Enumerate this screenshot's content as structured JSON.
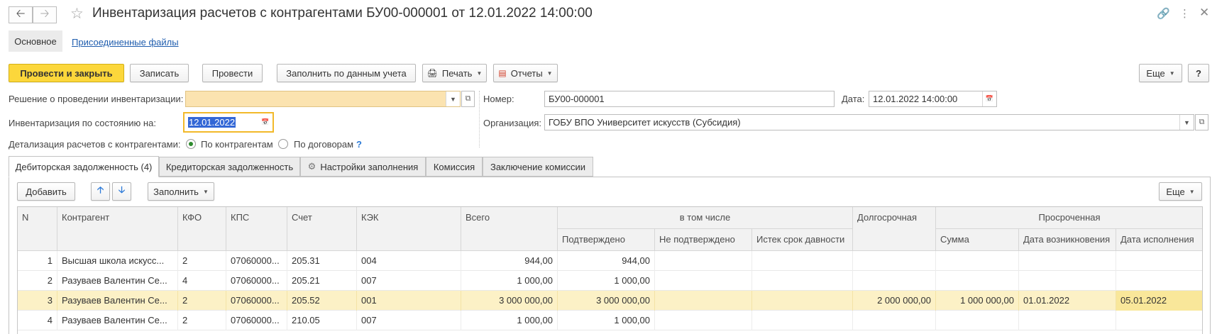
{
  "window": {
    "title": "Инвентаризация расчетов с контрагентами БУ00-000001 от 12.01.2022 14:00:00"
  },
  "section_tabs": {
    "main": "Основное",
    "files": "Присоединенные файлы"
  },
  "toolbar": {
    "post_close": "Провести и закрыть",
    "save": "Записать",
    "post": "Провести",
    "fill": "Заполнить по данным учета",
    "print": "Печать",
    "reports": "Отчеты",
    "more": "Еще",
    "help": "?"
  },
  "form": {
    "decision_label": "Решение о проведении инвентаризации:",
    "decision_value": "",
    "state_label": "Инвентаризация по состоянию на:",
    "state_value": "12.01.2022",
    "detail_label": "Детализация расчетов с контрагентами:",
    "detail_opt1": "По контрагентам",
    "detail_opt2": "По договорам",
    "detail_help": "?",
    "number_label": "Номер:",
    "number_value": "БУ00-000001",
    "date_label": "Дата:",
    "date_value": "12.01.2022 14:00:00",
    "org_label": "Организация:",
    "org_value": "ГОБУ ВПО Университет искусств (Субсидия)"
  },
  "doc_tabs": [
    "Дебиторская задолженность (4)",
    "Кредиторская задолженность",
    "Настройки заполнения",
    "Комиссия",
    "Заключение комиссии"
  ],
  "table_toolbar": {
    "add": "Добавить",
    "fill": "Заполнить",
    "more": "Еще"
  },
  "table": {
    "headers": {
      "n": "N",
      "contractor": "Контрагент",
      "kfo": "КФО",
      "kps": "КПС",
      "account": "Счет",
      "kek": "КЭК",
      "total": "Всего",
      "incl": "в том числе",
      "confirmed": "Подтверждено",
      "not_confirmed": "Не подтверждено",
      "expired": "Истек срок давности",
      "longterm": "Долгосрочная",
      "overdue": "Просроченная",
      "sum": "Сумма",
      "date_origin": "Дата возникновения",
      "date_exec": "Дата исполнения"
    },
    "rows": [
      {
        "n": "1",
        "contractor": "Высшая школа искусс...",
        "kfo": "2",
        "kps": "07060000...",
        "account": "205.31",
        "kek": "004",
        "total": "944,00",
        "confirmed": "944,00",
        "not_confirmed": "",
        "expired": "",
        "longterm": "",
        "sum": "",
        "date_origin": "",
        "date_exec": ""
      },
      {
        "n": "2",
        "contractor": "Разуваев Валентин Се...",
        "kfo": "4",
        "kps": "07060000...",
        "account": "205.21",
        "kek": "007",
        "total": "1 000,00",
        "confirmed": "1 000,00",
        "not_confirmed": "",
        "expired": "",
        "longterm": "",
        "sum": "",
        "date_origin": "",
        "date_exec": ""
      },
      {
        "n": "3",
        "contractor": "Разуваев Валентин Се...",
        "kfo": "2",
        "kps": "07060000...",
        "account": "205.52",
        "kek": "001",
        "total": "3 000 000,00",
        "confirmed": "3 000 000,00",
        "not_confirmed": "",
        "expired": "",
        "longterm": "2 000 000,00",
        "sum": "1 000 000,00",
        "date_origin": "01.01.2022",
        "date_exec": "05.01.2022"
      },
      {
        "n": "4",
        "contractor": "Разуваев Валентин Се...",
        "kfo": "2",
        "kps": "07060000...",
        "account": "210.05",
        "kek": "007",
        "total": "1 000,00",
        "confirmed": "1 000,00",
        "not_confirmed": "",
        "expired": "",
        "longterm": "",
        "sum": "",
        "date_origin": "",
        "date_exec": ""
      }
    ]
  }
}
